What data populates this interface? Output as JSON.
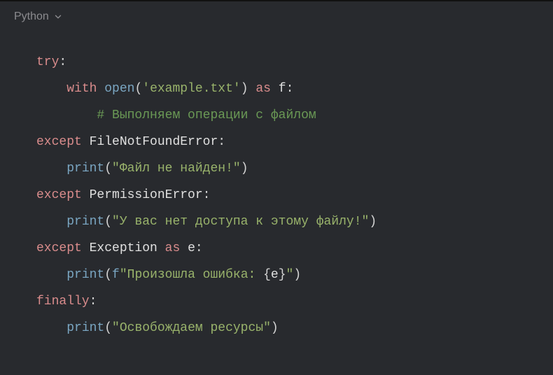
{
  "header": {
    "language_label": "Python"
  },
  "code": {
    "l1": {
      "kw": "try",
      "colon": ":"
    },
    "l2": {
      "kw_with": "with",
      "fn_open": "open",
      "op_p": "(",
      "str": "'example.txt'",
      "cl_p": ")",
      "kw_as": "as",
      "id_f": "f",
      "colon": ":"
    },
    "l3": {
      "comment": "# Выполняем операции с файлом"
    },
    "l4": {
      "kw": "except",
      "exc": "FileNotFoundError",
      "colon": ":"
    },
    "l5": {
      "fn": "print",
      "op_p": "(",
      "str": "\"Файл не найден!\"",
      "cl_p": ")"
    },
    "l6": {
      "kw": "except",
      "exc": "PermissionError",
      "colon": ":"
    },
    "l7": {
      "fn": "print",
      "op_p": "(",
      "str": "\"У вас нет доступа к этому файлу!\"",
      "cl_p": ")"
    },
    "l8": {
      "kw": "except",
      "exc": "Exception",
      "kw_as": "as",
      "id_e": "e",
      "colon": ":"
    },
    "l9": {
      "fn": "print",
      "op_p": "(",
      "pref": "f",
      "str1": "\"Произошла ошибка: ",
      "lb": "{",
      "id_e": "e",
      "rb": "}",
      "str2": "\"",
      "cl_p": ")"
    },
    "l10": {
      "kw": "finally",
      "colon": ":"
    },
    "l11": {
      "fn": "print",
      "op_p": "(",
      "str": "\"Освобождаем ресурсы\"",
      "cl_p": ")"
    }
  }
}
